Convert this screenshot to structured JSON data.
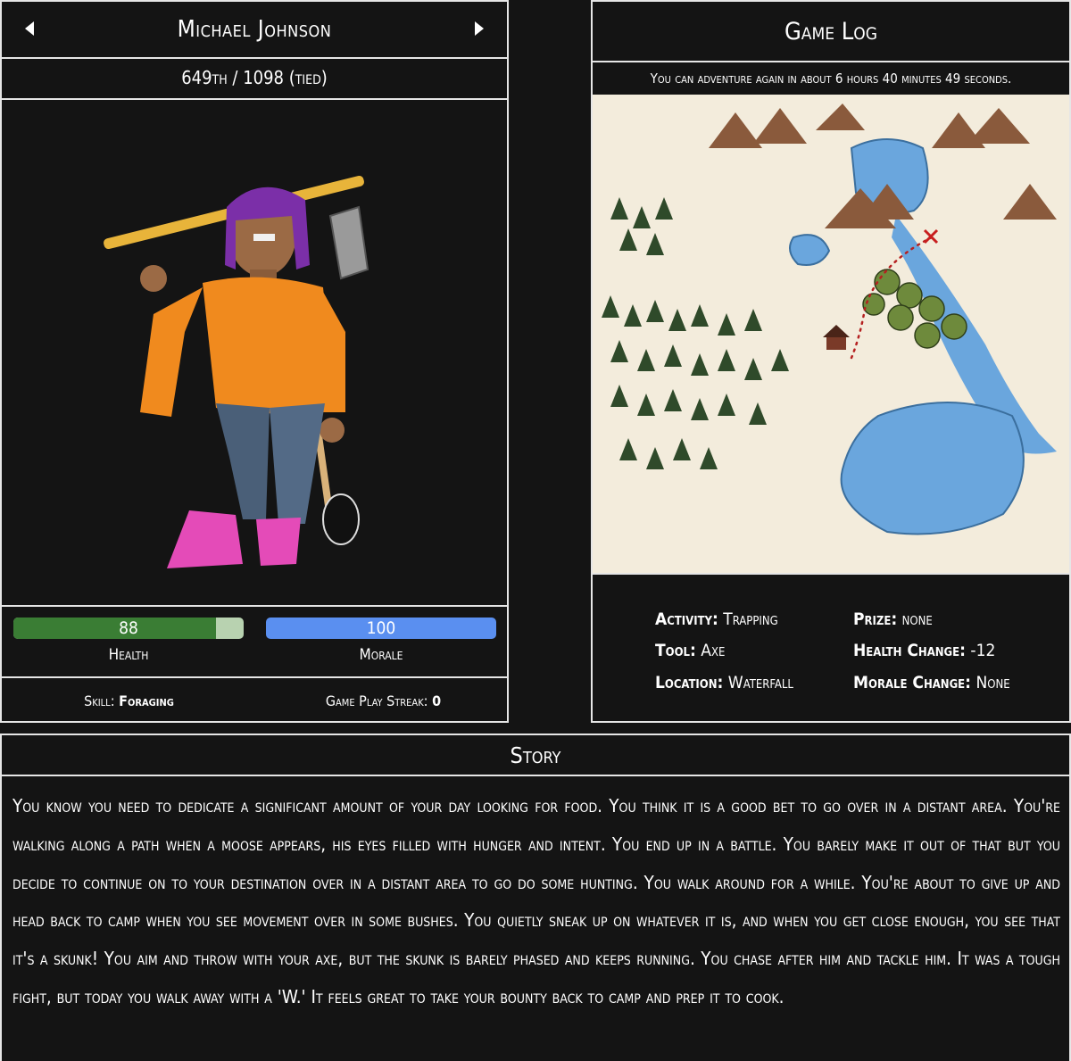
{
  "player": {
    "name": "Michael Johnson",
    "rank": "649th / 1098 (tied)"
  },
  "stats": {
    "health_value": "88",
    "health_fraction": 0.88,
    "health_label": "Health",
    "morale_value": "100",
    "morale_fraction": 1.0,
    "morale_label": "Morale",
    "skill_key": "Skill:",
    "skill_value": "Foraging",
    "streak_key": "Game Play Streak:",
    "streak_value": "0"
  },
  "colors": {
    "health": "#3a7d34",
    "health_track": "#b8d2b0",
    "morale": "#5a8ff0",
    "panel_border": "#e6e6e6",
    "background": "#141414"
  },
  "gamelog": {
    "title": "Game Log",
    "timer": "You can adventure again in about 6 hours 40 minutes 49 seconds.",
    "activity_key": "Activity:",
    "activity_value": "Trapping",
    "tool_key": "Tool:",
    "tool_value": "Axe",
    "location_key": "Location:",
    "location_value": "Waterfall",
    "prize_key": "Prize:",
    "prize_value": "none",
    "health_change_key": "Health Change:",
    "health_change_value": "-12",
    "morale_change_key": "Morale Change:",
    "morale_change_value": "None"
  },
  "story": {
    "title": "Story",
    "text": "You know you need to dedicate a significant amount of your day looking for food. You think it is a good bet to go over in a distant area. You're walking along a path when a moose appears, his eyes filled with hunger and intent. You end up in a battle. You barely make it out of that but you decide to continue on to your destination over in a distant area to go do some hunting. You walk around for a while. You're about to give up and head back to camp when you see movement over in some bushes. You quietly sneak up on whatever it is, and when you get close enough, you see that it's a skunk! You aim and throw with your axe, but the skunk is barely phased and keeps running. You chase after him and tackle him. It was a tough fight, but today you walk away with a 'W.' It feels great to take your bounty back to camp and prep it to cook."
  }
}
